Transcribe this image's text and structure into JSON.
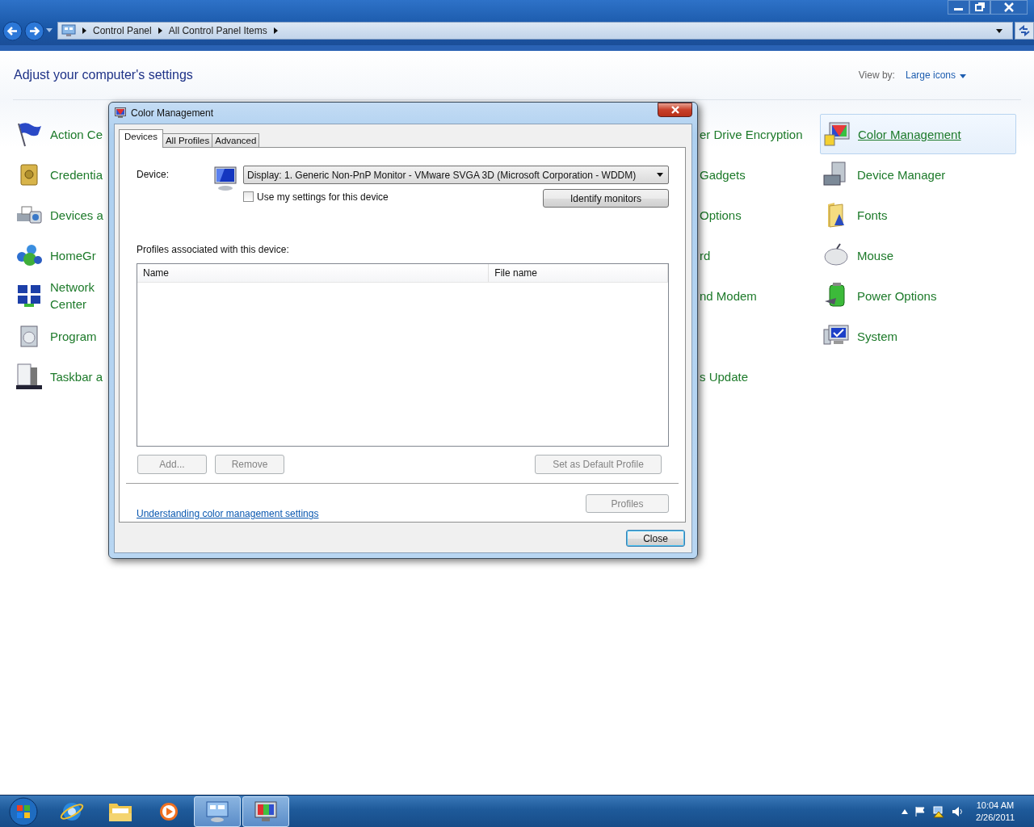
{
  "address_bar": {
    "breadcrumbs": [
      "Control Panel",
      "All Control Panel Items"
    ]
  },
  "header": {
    "title": "Adjust your computer's settings",
    "view_by_label": "View by:",
    "view_by_value": "Large icons"
  },
  "rows": [
    {
      "left": {
        "lines": [
          "Action Ce"
        ],
        "selected": false
      },
      "middle": {
        "lines": [
          "er Drive Encryption"
        ],
        "selected": false
      },
      "right": {
        "lines": [
          "Color Management"
        ],
        "selected": true
      }
    },
    {
      "left": {
        "lines": [
          "Credentia"
        ],
        "selected": false
      },
      "middle": {
        "lines": [
          "Gadgets"
        ],
        "selected": false
      },
      "right": {
        "lines": [
          "Device Manager"
        ],
        "selected": false
      }
    },
    {
      "left": {
        "lines": [
          "Devices a"
        ],
        "selected": false
      },
      "middle": {
        "lines": [
          "Options"
        ],
        "selected": false
      },
      "right": {
        "lines": [
          "Fonts"
        ],
        "selected": false
      }
    },
    {
      "left": {
        "lines": [
          "HomeGr"
        ],
        "selected": false
      },
      "middle": {
        "lines": [
          "rd"
        ],
        "selected": false
      },
      "right": {
        "lines": [
          "Mouse"
        ],
        "selected": false
      }
    },
    {
      "left": {
        "lines": [
          "Network",
          "Center"
        ],
        "selected": false
      },
      "middle": {
        "lines": [
          "nd Modem"
        ],
        "selected": false
      },
      "right": {
        "lines": [
          "Power Options"
        ],
        "selected": false
      }
    },
    {
      "left": {
        "lines": [
          "Program"
        ],
        "selected": false
      },
      "right": {
        "lines": [
          "System"
        ],
        "selected": false
      }
    },
    {
      "left": {
        "lines": [
          "Taskbar a"
        ],
        "selected": false
      },
      "middle": {
        "lines": [
          "s Update"
        ],
        "selected": false
      }
    }
  ],
  "dialog": {
    "title": "Color Management",
    "tabs": [
      {
        "label": "Devices",
        "selected": true
      },
      {
        "label": "All Profiles",
        "selected": false
      },
      {
        "label": "Advanced",
        "selected": false
      }
    ],
    "device_label": "Device:",
    "device_value": "Display: 1. Generic Non-PnP Monitor - VMware SVGA 3D (Microsoft Corporation - WDDM)",
    "use_my_settings": {
      "label": "Use my settings for this device",
      "checked": false
    },
    "identify_button": "Identify monitors",
    "profiles_label": "Profiles associated with this device:",
    "table": {
      "columns": [
        "Name",
        "File name"
      ]
    },
    "buttons": [
      {
        "label": "Add...",
        "disabled": true
      },
      {
        "label": "Remove",
        "disabled": true
      },
      {
        "label": "Set as Default Profile",
        "disabled": true
      }
    ],
    "help_link": "Understanding color management settings",
    "profiles_button": {
      "label": "Profiles",
      "disabled": true
    },
    "close_button": "Close"
  },
  "taskbar": {
    "apps": [
      {
        "active": false
      },
      {
        "active": false
      },
      {
        "active": false
      },
      {
        "active": true
      },
      {
        "active": true
      }
    ],
    "clock": {
      "time": "10:04 AM",
      "date": "2/26/2011"
    }
  }
}
